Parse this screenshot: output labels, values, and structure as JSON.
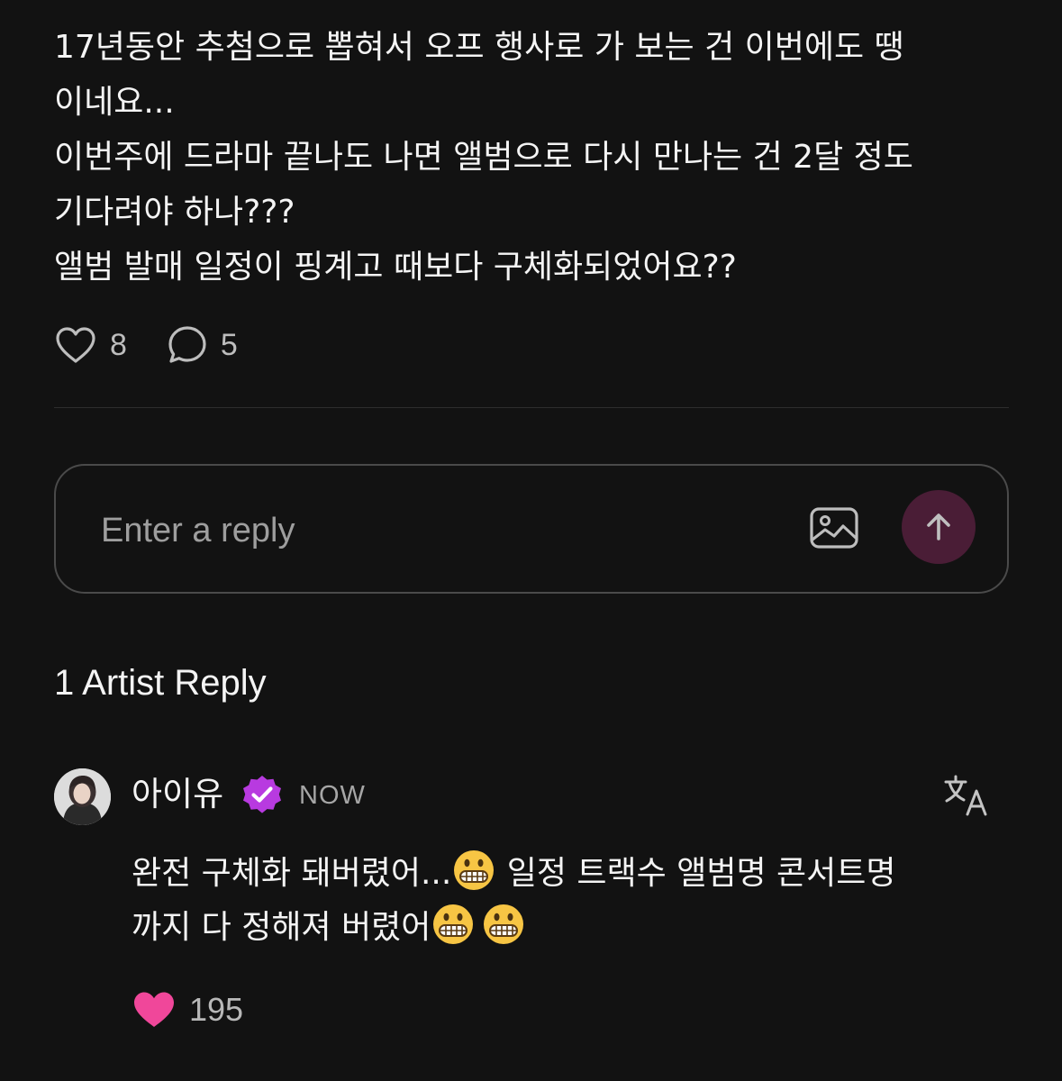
{
  "post": {
    "lines": [
      "17년동안 추첨으로 뽑혀서 오프 행사로 가 보는 건 이번에도 땡",
      "이네요...",
      "이번주에 드라마 끝나도 나면 앨범으로 다시 만나는 건 2달 정도",
      "기다려야 하나???",
      "앨범 발매 일정이 핑계고 때보다 구체화되었어요??"
    ],
    "like_count": "8",
    "comment_count": "5"
  },
  "reply_input": {
    "placeholder": "Enter a reply"
  },
  "section": {
    "title": "1 Artist Reply"
  },
  "artist_reply": {
    "author": "아이유",
    "timestamp": "NOW",
    "line1_before": "완전 구체화 돼버렸어...",
    "line1_after": " 일정 트랙수 앨범명 콘서트명",
    "line2": "까지 다 정해져 버렸어",
    "like_count": "195"
  },
  "colors": {
    "background": "#121212",
    "send_button": "#4a1d36",
    "verified_badge": "#b83ae0",
    "like_heart": "#f0479a"
  },
  "icons": {
    "like": "heart-outline-icon",
    "comment": "speech-bubble-icon",
    "image": "image-icon",
    "send": "arrow-up-icon",
    "verified": "verified-badge-icon",
    "translate": "translate-icon",
    "reply_like": "heart-filled-icon",
    "emoji": "grimacing-face-emoji"
  }
}
